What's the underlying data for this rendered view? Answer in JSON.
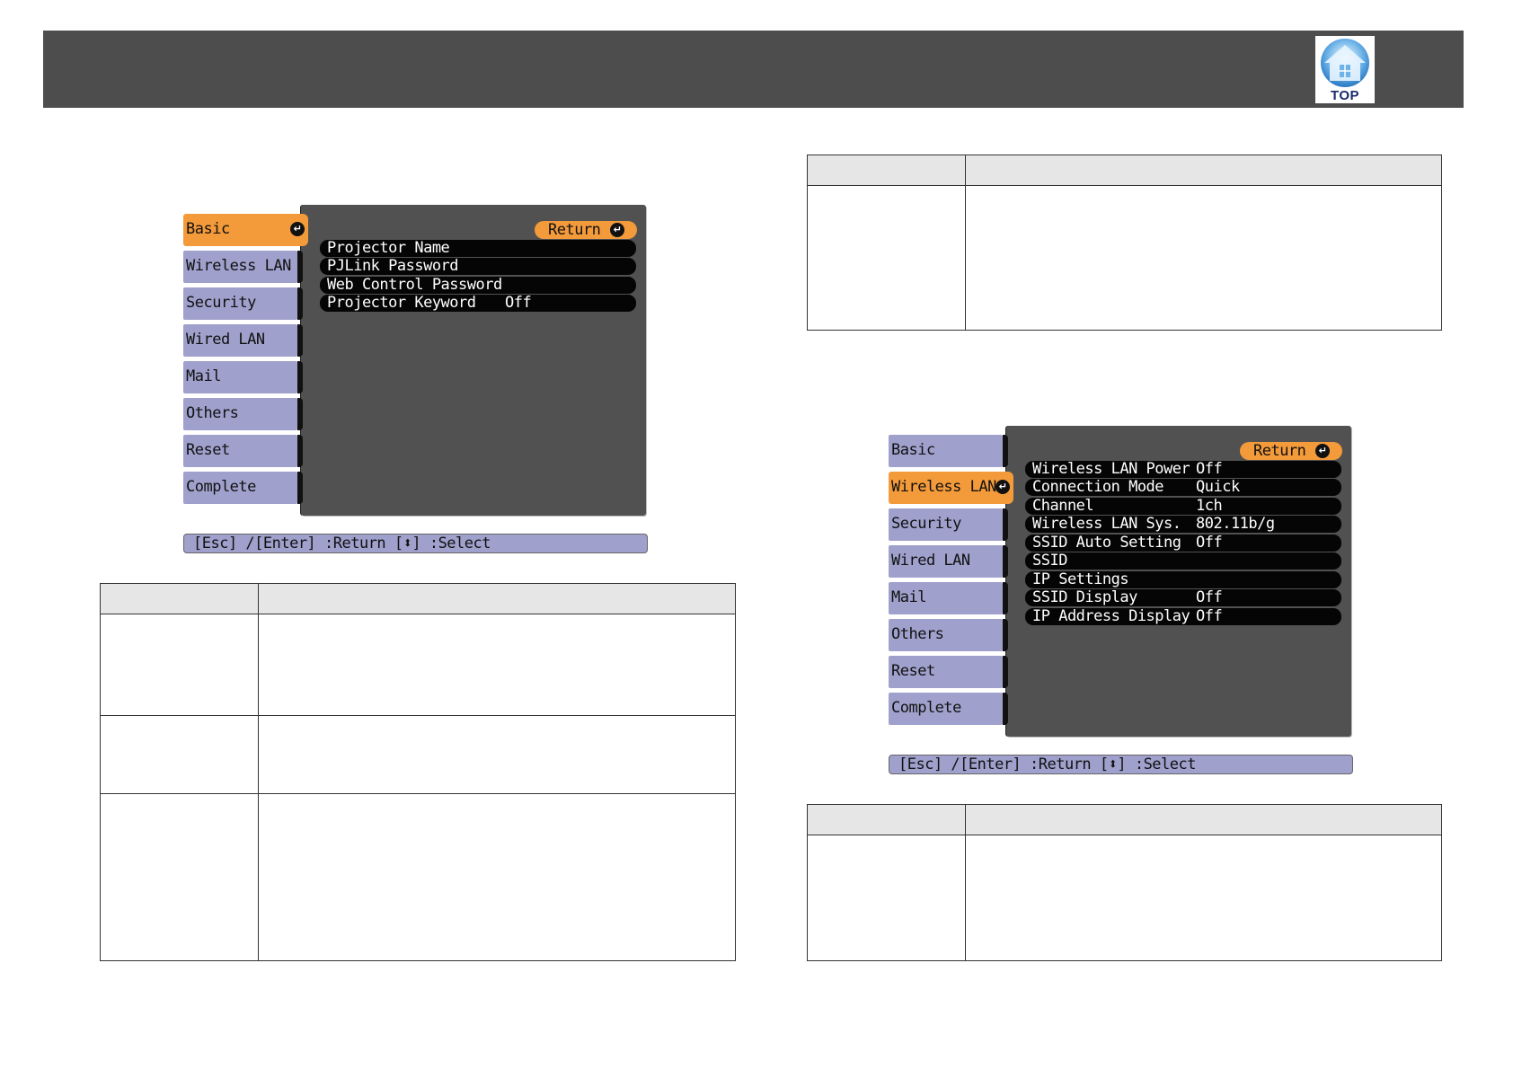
{
  "header": {
    "top_link_label": "TOP"
  },
  "menu_left": {
    "sidebar": [
      "Basic",
      "Wireless LAN",
      "Security",
      "Wired LAN",
      "Mail",
      "Others",
      "Reset",
      "Complete"
    ],
    "active_item": "Basic",
    "return_label": "Return",
    "rows": [
      {
        "label": "Projector Name",
        "value": ""
      },
      {
        "label": "PJLink Password",
        "value": ""
      },
      {
        "label": "Web Control Password",
        "value": ""
      },
      {
        "label": "Projector Keyword",
        "value": "Off"
      }
    ],
    "status_bar": "[Esc] /[Enter] :Return  [⬍] :Select"
  },
  "menu_right": {
    "sidebar": [
      "Basic",
      "Wireless LAN",
      "Security",
      "Wired LAN",
      "Mail",
      "Others",
      "Reset",
      "Complete"
    ],
    "active_item": "Wireless LAN",
    "return_label": "Return",
    "rows": [
      {
        "label": "Wireless LAN Power",
        "value": "Off"
      },
      {
        "label": "Connection Mode",
        "value": "Quick"
      },
      {
        "label": "Channel",
        "value": "1ch"
      },
      {
        "label": "Wireless LAN Sys.",
        "value": "802.11b/g"
      },
      {
        "label": "SSID Auto Setting",
        "value": "Off"
      },
      {
        "label": "SSID",
        "value": ""
      },
      {
        "label": "IP Settings",
        "value": ""
      },
      {
        "label": "SSID Display",
        "value": "Off"
      },
      {
        "label": "IP Address Display",
        "value": "Off"
      }
    ],
    "status_bar": "[Esc] /[Enter] :Return  [⬍] :Select"
  },
  "colors": {
    "header_bar": "#4d4d4d",
    "menu_panel": "#515151",
    "sidebar_item": "#9fa0cc",
    "active_highlight": "#f39a3a",
    "table_header": "#e6e6e6"
  }
}
